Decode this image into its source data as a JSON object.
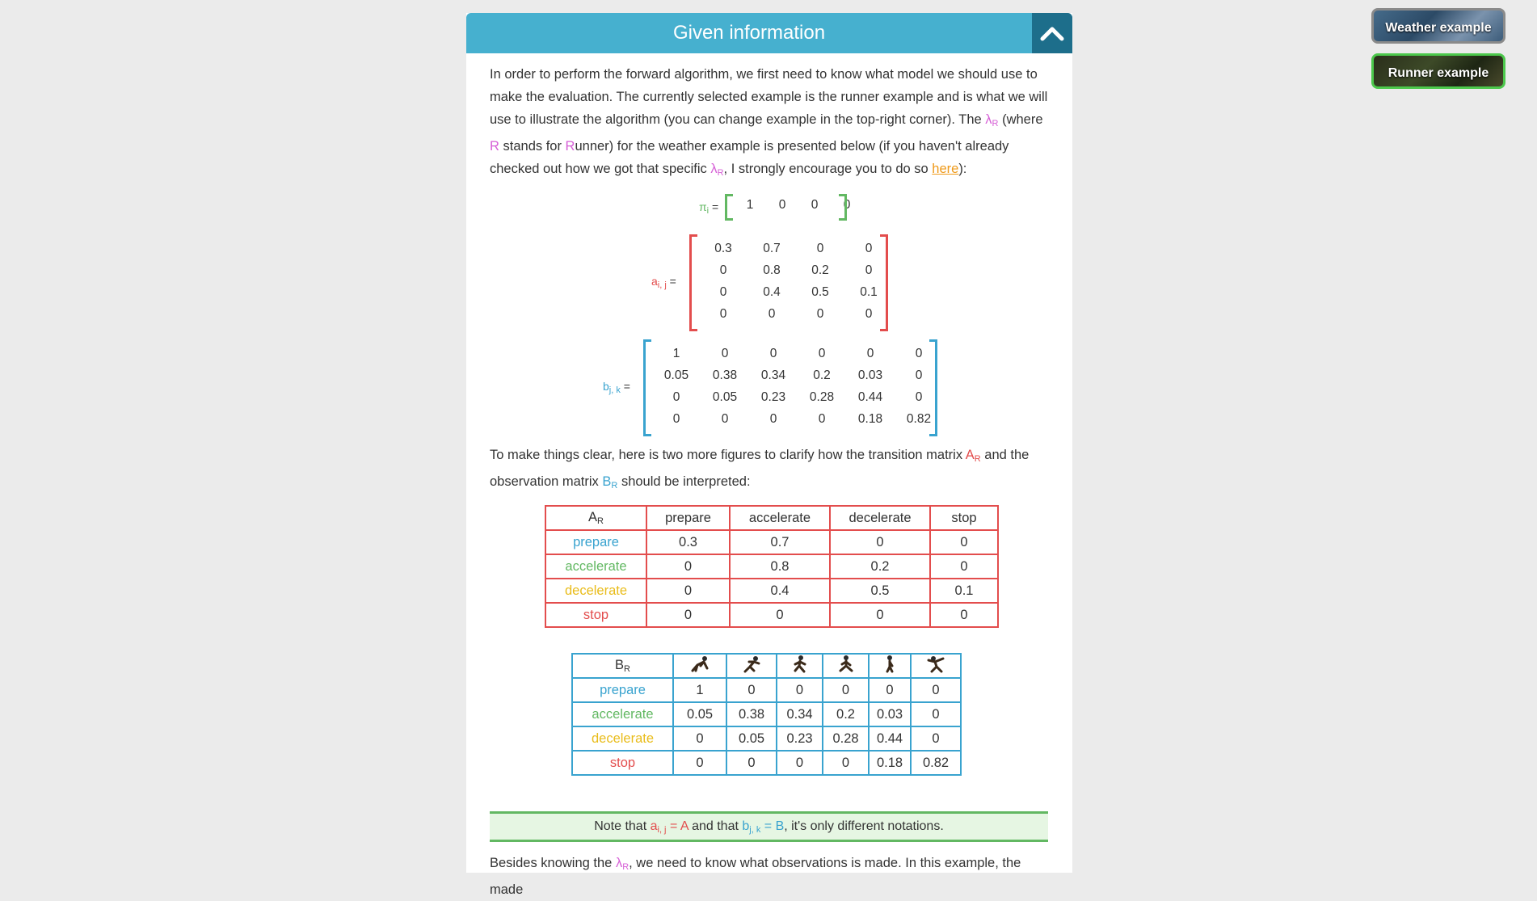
{
  "panel": {
    "title": "Given information"
  },
  "examples": {
    "weather": "Weather example",
    "runner": "Runner example"
  },
  "intro": {
    "t1": "In order to perform the forward algorithm, we first need to know what model we should use to make the evaluation. The currently selected example is the runner example and is what we will use to illustrate the algorithm (you can change example in the top-right corner). The ",
    "lambda": "λ",
    "sub_r": "R",
    "t2": " (where ",
    "r_letter": "R",
    "t3": " stands for ",
    "r_letter2": "R",
    "t4": "unner) for the weather example is presented below (if you haven't already checked out how we got that specific ",
    "t5": ", I strongly encourage you to do so ",
    "link": "here",
    "t6": "):"
  },
  "pi": {
    "label": "π",
    "sub": "i",
    "eq": " =",
    "values": [
      "1",
      "0",
      "0",
      "0"
    ]
  },
  "a": {
    "label": "a",
    "sub": "i, j",
    "eq": " =",
    "rows": [
      [
        "0.3",
        "0.7",
        "0",
        "0"
      ],
      [
        "0",
        "0.8",
        "0.2",
        "0"
      ],
      [
        "0",
        "0.4",
        "0.5",
        "0.1"
      ],
      [
        "0",
        "0",
        "0",
        "0"
      ]
    ]
  },
  "b": {
    "label": "b",
    "sub": "j, k",
    "eq": " =",
    "rows": [
      [
        "1",
        "0",
        "0",
        "0",
        "0",
        "0"
      ],
      [
        "0.05",
        "0.38",
        "0.34",
        "0.2",
        "0.03",
        "0"
      ],
      [
        "0",
        "0.05",
        "0.23",
        "0.28",
        "0.44",
        "0"
      ],
      [
        "0",
        "0",
        "0",
        "0",
        "0.18",
        "0.82"
      ]
    ]
  },
  "clarify": {
    "t1": "To make things clear, here is two more figures to clarify how the transition matrix ",
    "a_letter": "A",
    "sub": "R",
    "t2": " and the observation matrix ",
    "b_letter": "B",
    "t3": " should be interpreted:"
  },
  "tableA": {
    "corner": "A",
    "corner_sub": "R",
    "headers": [
      "prepare",
      "accelerate",
      "decelerate",
      "stop"
    ],
    "rows": [
      {
        "label": "prepare",
        "values": [
          "0.3",
          "0.7",
          "0",
          "0"
        ]
      },
      {
        "label": "accelerate",
        "values": [
          "0",
          "0.8",
          "0.2",
          "0"
        ]
      },
      {
        "label": "decelerate",
        "values": [
          "0",
          "0.4",
          "0.5",
          "0.1"
        ]
      },
      {
        "label": "stop",
        "values": [
          "0",
          "0",
          "0",
          "0"
        ]
      }
    ]
  },
  "tableB": {
    "corner": "B",
    "corner_sub": "R",
    "icons": [
      "runner-crouch-icon",
      "runner-sprint-icon",
      "runner-run-icon",
      "runner-stride-icon",
      "runner-walk-icon",
      "runner-finish-icon"
    ],
    "rows": [
      {
        "label": "prepare",
        "values": [
          "1",
          "0",
          "0",
          "0",
          "0",
          "0"
        ]
      },
      {
        "label": "accelerate",
        "values": [
          "0.05",
          "0.38",
          "0.34",
          "0.2",
          "0.03",
          "0"
        ]
      },
      {
        "label": "decelerate",
        "values": [
          "0",
          "0.05",
          "0.23",
          "0.28",
          "0.44",
          "0"
        ]
      },
      {
        "label": "stop",
        "values": [
          "0",
          "0",
          "0",
          "0",
          "0.18",
          "0.82"
        ]
      }
    ]
  },
  "note": {
    "t1": "Note that ",
    "a": "a",
    "a_sub": "i, j",
    "eqA": " = A",
    "t2": " and that ",
    "b": "b",
    "b_sub": "j, k",
    "eqB": " = B",
    "t3": ", it's only different notations."
  },
  "besides": {
    "t1": "Besides knowing the ",
    "lambda": "λ",
    "sub": "R",
    "t2": ", we need to know what observations is made. In this example, the made"
  },
  "colors": {
    "header": "#46b0cf",
    "red": "#e34d4d",
    "green": "#62b862",
    "blue": "#39a3cf",
    "yellow": "#e9bc1a",
    "pink": "#d65fd6",
    "link": "#ef9a1a"
  }
}
